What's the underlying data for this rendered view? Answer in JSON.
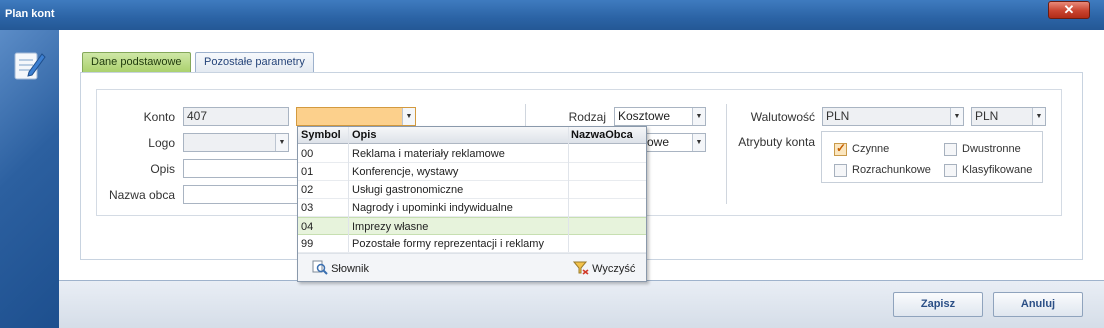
{
  "window": {
    "title": "Plan kont",
    "close": "✕"
  },
  "tabs": [
    {
      "label": "Dane podstawowe"
    },
    {
      "label": "Pozostałe parametry"
    }
  ],
  "form": {
    "konto_label": "Konto",
    "konto_value": "407",
    "logo_label": "Logo",
    "opis_label": "Opis",
    "nazwa_obca_label": "Nazwa obca",
    "rodzaj_label": "Rodzaj",
    "rodzaj_value": "Kosztowe",
    "rodzaj2_value": "owe",
    "walutowosc_label": "Walutowość",
    "waluta1_value": "PLN",
    "waluta2_value": "PLN",
    "atrybuty_label": "Atrybuty konta",
    "atrybuty": [
      {
        "label": "Czynne",
        "checked": true
      },
      {
        "label": "Dwustronne",
        "checked": false
      },
      {
        "label": "Rozrachunkowe",
        "checked": false
      },
      {
        "label": "Klasyfikowane",
        "checked": false
      }
    ]
  },
  "dropdown": {
    "columns": [
      "Symbol",
      "Opis",
      "NazwaObca"
    ],
    "rows": [
      {
        "symbol": "00",
        "opis": "Reklama i materiały reklamowe",
        "nazwa_obca": ""
      },
      {
        "symbol": "01",
        "opis": "Konferencje, wystawy",
        "nazwa_obca": ""
      },
      {
        "symbol": "02",
        "opis": "Usługi gastronomiczne",
        "nazwa_obca": ""
      },
      {
        "symbol": "03",
        "opis": "Nagrody i upominki indywidualne",
        "nazwa_obca": ""
      },
      {
        "symbol": "04",
        "opis": "Imprezy własne",
        "nazwa_obca": "",
        "highlighted": true
      },
      {
        "symbol": "99",
        "opis": "Pozostałe formy reprezentacji i reklamy",
        "nazwa_obca": ""
      }
    ],
    "slownik_label": "Słownik",
    "wyczysc_label": "Wyczyść"
  },
  "footer": {
    "save_label": "Zapisz",
    "cancel_label": "Anuluj"
  },
  "colors": {
    "accent": "#2b63a5",
    "highlight_row": "#e7f3dc",
    "combo_active": "#fcd08c"
  }
}
